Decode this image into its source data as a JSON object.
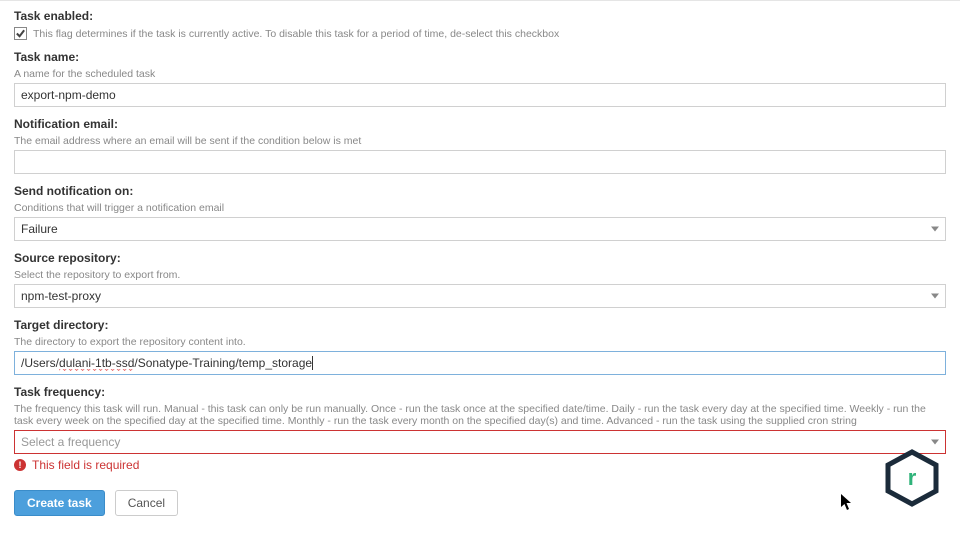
{
  "task_enabled": {
    "label": "Task enabled:",
    "help": "This flag determines if the task is currently active. To disable this task for a period of time, de-select this checkbox",
    "checked": true
  },
  "task_name": {
    "label": "Task name:",
    "help": "A name for the scheduled task",
    "value": "export-npm-demo"
  },
  "notification_email": {
    "label": "Notification email:",
    "help": "The email address where an email will be sent if the condition below is met",
    "value": ""
  },
  "send_notification_on": {
    "label": "Send notification on:",
    "help": "Conditions that will trigger a notification email",
    "value": "Failure"
  },
  "source_repository": {
    "label": "Source repository:",
    "help": "Select the repository to export from.",
    "value": "npm-test-proxy"
  },
  "target_directory": {
    "label": "Target directory:",
    "help": "The directory to export the repository content into.",
    "value_prefix": "/Users/",
    "value_squiggle": "dulani-1tb-ssd",
    "value_suffix": "/Sonatype-Training/temp_storage"
  },
  "task_frequency": {
    "label": "Task frequency:",
    "help": "The frequency this task will run. Manual - this task can only be run manually. Once - run the task once at the specified date/time. Daily - run the task every day at the specified time. Weekly - run the task every week on the specified day at the specified time. Monthly - run the task every month on the specified day(s) and time. Advanced - run the task using the supplied cron string",
    "placeholder": "Select a frequency",
    "error": "This field is required"
  },
  "buttons": {
    "create": "Create task",
    "cancel": "Cancel"
  }
}
